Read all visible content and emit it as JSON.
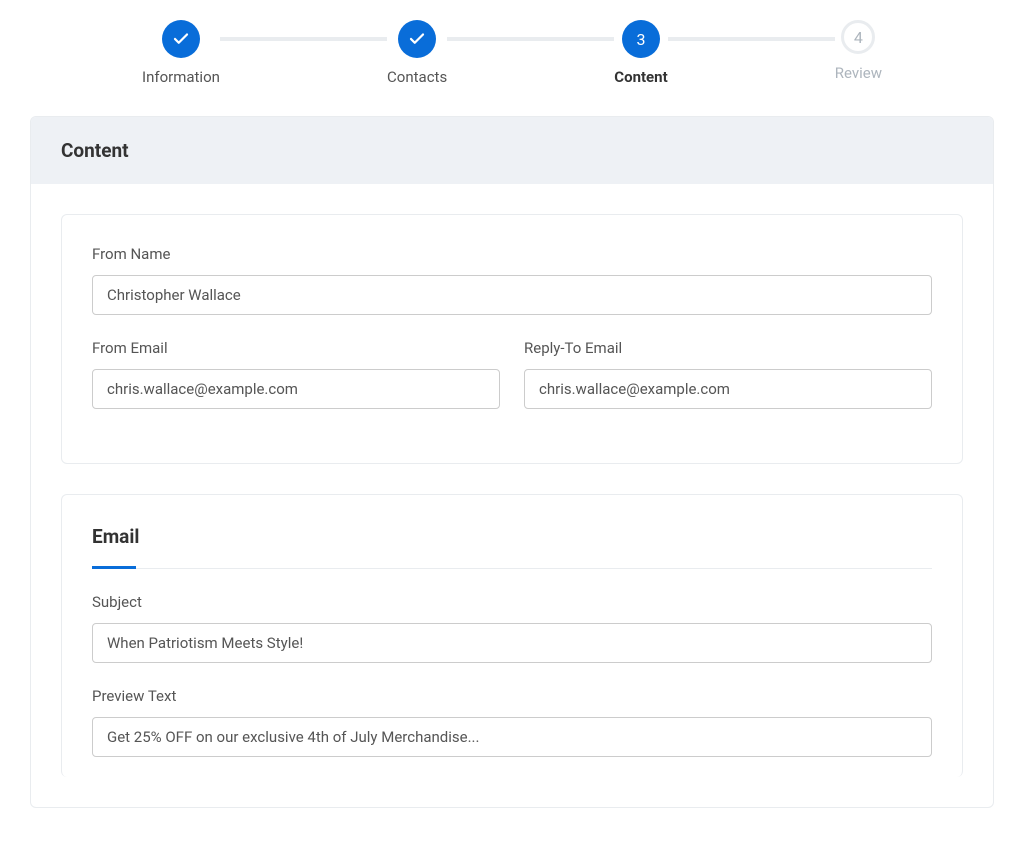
{
  "stepper": {
    "steps": [
      {
        "label": "Information",
        "state": "completed"
      },
      {
        "label": "Contacts",
        "state": "completed"
      },
      {
        "label": "Content",
        "number": "3",
        "state": "current"
      },
      {
        "label": "Review",
        "number": "4",
        "state": "pending"
      }
    ]
  },
  "panel": {
    "title": "Content"
  },
  "form": {
    "from_name": {
      "label": "From Name",
      "value": "Christopher Wallace"
    },
    "from_email": {
      "label": "From Email",
      "value": "chris.wallace@example.com"
    },
    "reply_to_email": {
      "label": "Reply-To Email",
      "value": "chris.wallace@example.com"
    }
  },
  "email_section": {
    "title": "Email",
    "subject": {
      "label": "Subject",
      "value": "When Patriotism Meets Style!"
    },
    "preview_text": {
      "label": "Preview Text",
      "value": "Get 25% OFF on our exclusive 4th of July Merchandise..."
    }
  }
}
